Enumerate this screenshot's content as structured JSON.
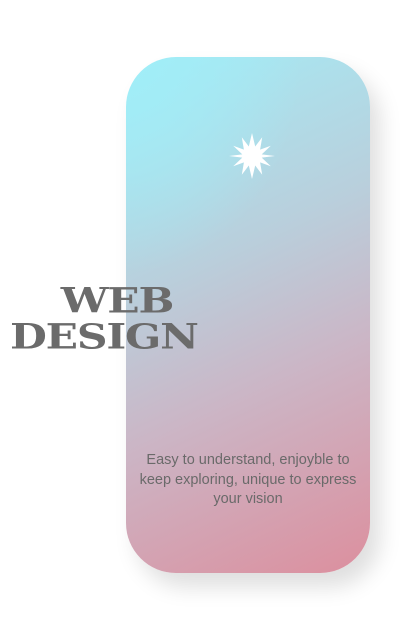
{
  "card": {
    "gradient_colors": [
      "#a4ecf6",
      "#b9cfdc",
      "#cbb6c6",
      "#dc8f9e"
    ]
  },
  "decoration": {
    "icon": "sparkle-star-icon",
    "color": "#ffffff"
  },
  "title": {
    "line1": "WEB",
    "line2": "DESIGN",
    "color": "#6b6b6b"
  },
  "tagline": {
    "text": "Easy to understand, enjoyble to keep exploring, unique to express your vision",
    "color": "#6a6a6a"
  }
}
